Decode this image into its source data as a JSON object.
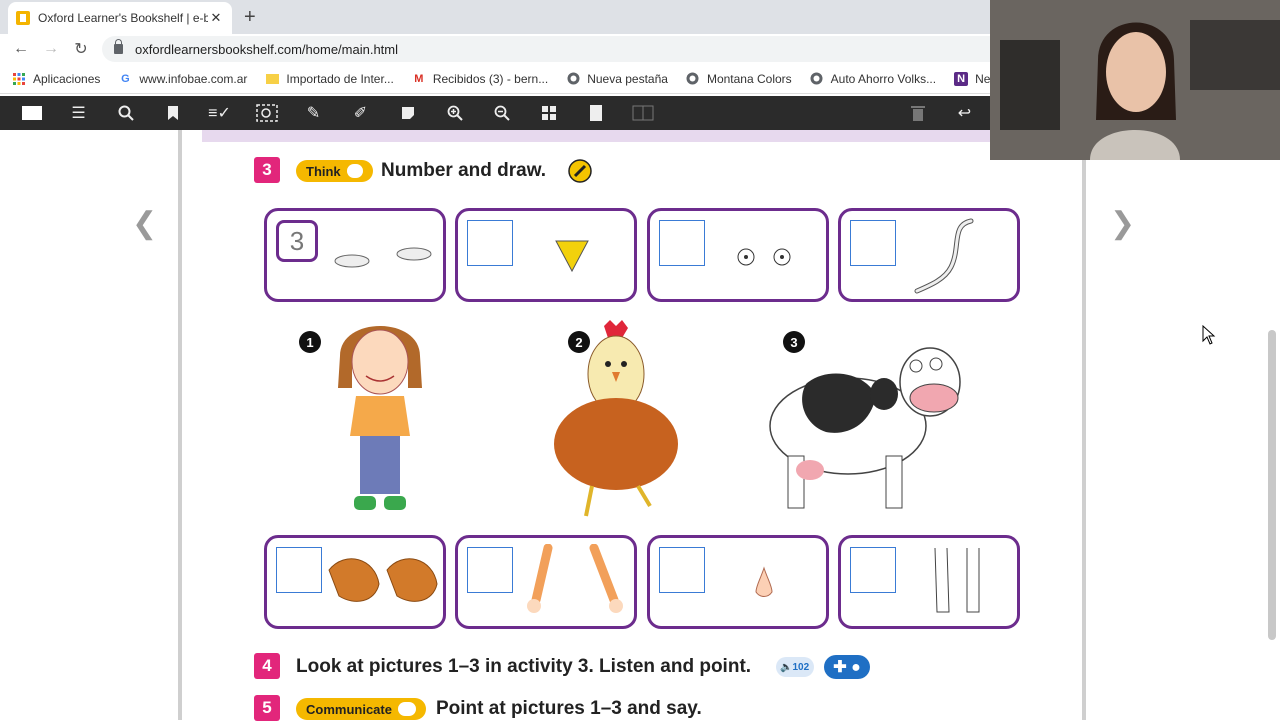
{
  "browser": {
    "tab_title": "Oxford Learner's Bookshelf | e-bc",
    "url": "oxfordlearnersbookshelf.com/home/main.html",
    "bookmarks": [
      {
        "label": "Aplicaciones",
        "icon": "apps-grid-icon"
      },
      {
        "label": "www.infobae.com.ar",
        "icon": "google-icon"
      },
      {
        "label": "Importado de Inter...",
        "icon": "folder-icon"
      },
      {
        "label": "Recibidos (3) - bern...",
        "icon": "gmail-icon"
      },
      {
        "label": "Nueva pestaña",
        "icon": "globe-icon"
      },
      {
        "label": "Montana Colors",
        "icon": "globe-icon"
      },
      {
        "label": "Auto Ahorro Volks...",
        "icon": "globe-icon"
      },
      {
        "label": "Netshoes -",
        "icon": "netshoes-icon"
      }
    ]
  },
  "activity3": {
    "number": "3",
    "tag": "Think",
    "title": "Number and draw.",
    "example_answer": "3",
    "people": [
      {
        "num": "1",
        "name": "girl"
      },
      {
        "num": "2",
        "name": "hen"
      },
      {
        "num": "3",
        "name": "cow"
      }
    ]
  },
  "activity4": {
    "number": "4",
    "title": "Look at pictures 1–3 in activity 3. Listen and point.",
    "audio_track": "102"
  },
  "activity5": {
    "number": "5",
    "tag": "Communicate",
    "title": "Point at pictures 1–3 and say."
  },
  "colors": {
    "accent": "#6c2c8d",
    "badge": "#e2267b",
    "tag": "#f5b800"
  }
}
